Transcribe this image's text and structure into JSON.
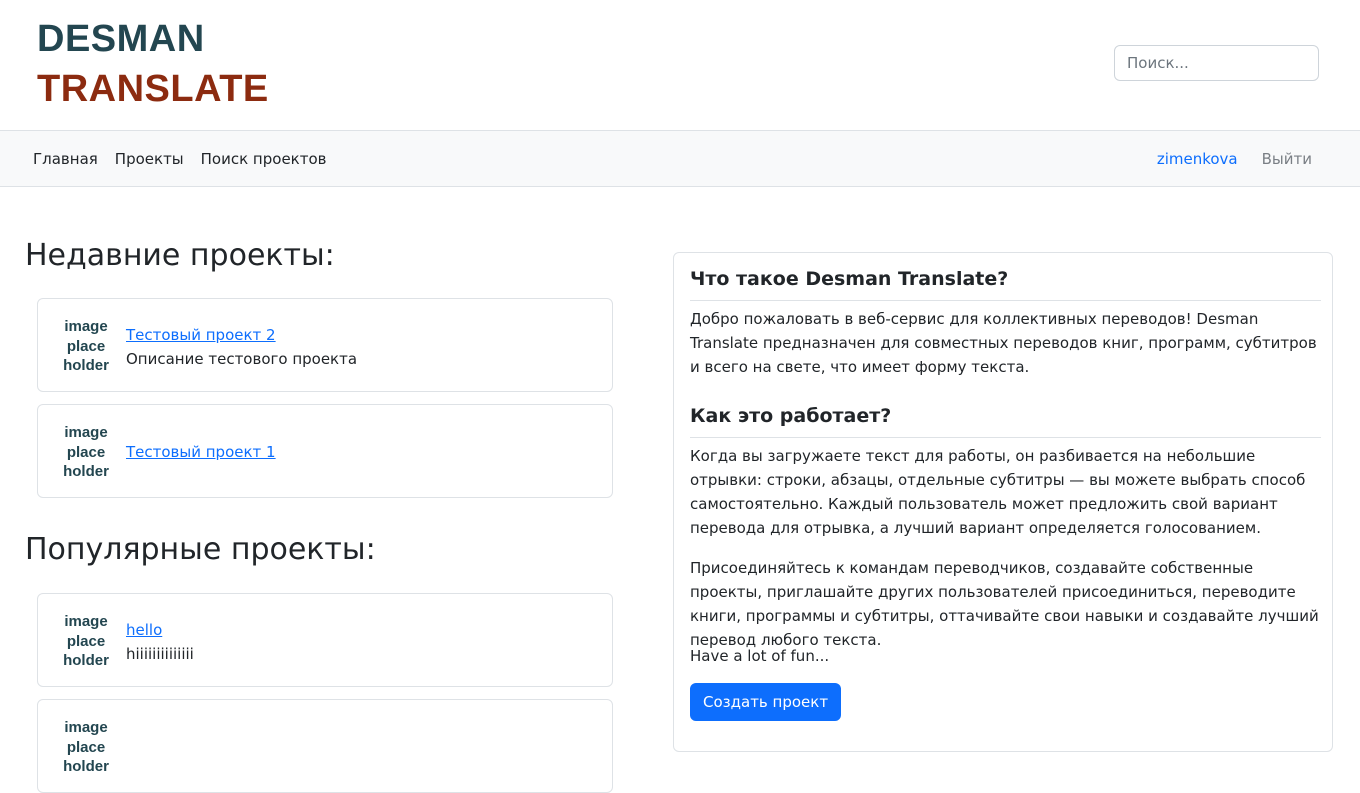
{
  "logo": {
    "line1": "DESMAN",
    "line2": "TRANSLATE"
  },
  "search": {
    "placeholder": "Поиск..."
  },
  "nav": {
    "items": [
      "Главная",
      "Проекты",
      "Поиск проектов"
    ],
    "user": "zimenkova",
    "logout": "Выйти"
  },
  "recent": {
    "title": "Недавние проекты:",
    "projects": [
      {
        "placeholder": [
          "image",
          "place",
          "holder"
        ],
        "name": "Тестовый проект 2",
        "description": "Описание тестового проекта"
      },
      {
        "placeholder": [
          "image",
          "place",
          "holder"
        ],
        "name": "Тестовый проект 1",
        "description": ""
      }
    ]
  },
  "popular": {
    "title": "Популярные проекты:",
    "projects": [
      {
        "placeholder": [
          "image",
          "place",
          "holder"
        ],
        "name": "hello",
        "description": "hiiiiiiiiiiiiii"
      },
      {
        "placeholder": [
          "image",
          "place",
          "holder"
        ],
        "name": "",
        "description": ""
      }
    ]
  },
  "about": {
    "heading1": "Что такое Desman Translate?",
    "p1": "Добро пожаловать в веб-сервис для коллективных переводов! Desman Translate предназначен для совместных переводов книг, программ, субтитров и всего на свете, что имеет форму текста.",
    "heading2": "Как это работает?",
    "p2": "Когда вы загружаете текст для работы, он разбивается на небольшие отрывки: строки, абзацы, отдельные субтитры — вы можете выбрать способ самостоятельно. Каждый пользователь может предложить свой вариант перевода для отрывка, а лучший вариант определяется голосованием.",
    "p3": "Присоединяйтесь к командам переводчиков, создавайте собственные проекты, приглашайте других пользователей присоединиться, переводите книги, программы и субтитры, оттачивайте свои навыки и создавайте лучший перевод любого текста.",
    "p4": "Have a lot of fun...",
    "button": "Создать проект"
  },
  "colors": {
    "accent": "#0d6efd",
    "logo_dark": "#234650",
    "logo_red": "#8c2b10",
    "navbar_bg": "#f8f9fa"
  }
}
